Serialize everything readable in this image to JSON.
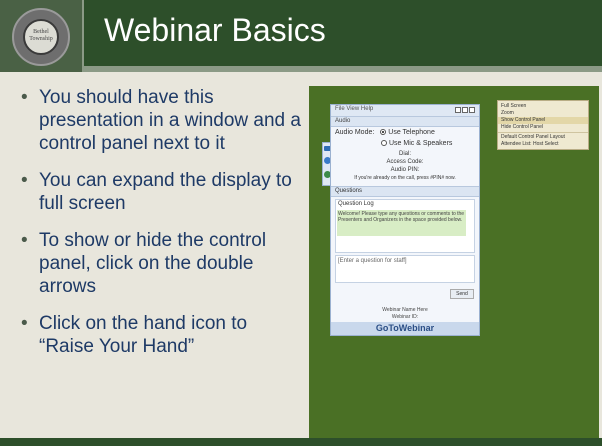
{
  "slide": {
    "title": "Webinar Basics",
    "logo_text": "Bethel Township",
    "colors": {
      "header": "#2d4f2a",
      "background": "#e8e6dc",
      "bullet_text": "#1e3a66",
      "image_panel": "#4a7025"
    }
  },
  "bullets": [
    "You should have this presentation in a window and a control panel next to it",
    "You can expand the display to full screen",
    "To show or hide the control panel, click on the double arrows",
    "Click on the hand icon to “Raise Your Hand”"
  ],
  "bullet_glyph": "•",
  "webinar_window": {
    "title": "File  View  Help",
    "audio_section": "Audio",
    "audio_mode_label": "Audio Mode:",
    "option_telephone": "Use Telephone",
    "option_mic": "Use Mic & Speakers",
    "dial_label": "Dial:",
    "access_code_label": "Access Code:",
    "audio_pin_label": "Audio PIN:",
    "audio_note": "If you're already on the call, press #PIN# now.",
    "questions_section": "Questions",
    "question_log_label": "Question Log",
    "question_log_text": "Welcome! Please type any questions or comments to the Presenters and Organizers in the space provided below.",
    "question_placeholder": "[Enter a question for staff]",
    "send_label": "Send",
    "footer_line1": "Webinar Name Here",
    "footer_line2": "Webinar ID:",
    "brand": "GoToWebinar"
  },
  "menu": {
    "items": [
      "Full Screen",
      "Zoom",
      "Show Control Panel",
      "Hide Control Panel",
      "Default Control Panel Layout",
      "Attendee List: Host Select"
    ]
  }
}
